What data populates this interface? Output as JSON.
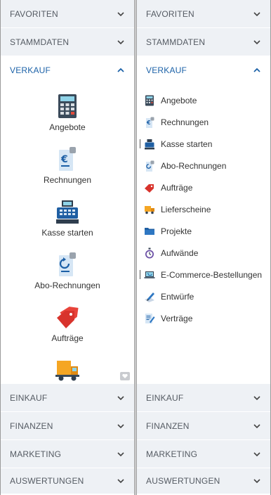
{
  "left_panel": {
    "sections_top": [
      "FAVORITEN",
      "STAMMDATEN"
    ],
    "open_section": "VERKAUF",
    "tiles": [
      {
        "label": "Angebote",
        "icon": "calculator-icon"
      },
      {
        "label": "Rechnungen",
        "icon": "invoice-euro-icon"
      },
      {
        "label": "Kasse starten",
        "icon": "cash-register-icon"
      },
      {
        "label": "Abo-Rechnungen",
        "icon": "recurring-invoice-icon"
      },
      {
        "label": "Aufträge",
        "icon": "tags-icon"
      },
      {
        "label": "",
        "icon": "delivery-truck-icon"
      }
    ],
    "sections_bottom": [
      "EINKAUF",
      "FINANZEN",
      "MARKETING",
      "AUSWERTUNGEN"
    ]
  },
  "right_panel": {
    "sections_top": [
      "FAVORITEN",
      "STAMMDATEN"
    ],
    "open_section": "VERKAUF",
    "items": [
      {
        "label": "Angebote",
        "icon": "calculator-icon"
      },
      {
        "label": "Rechnungen",
        "icon": "invoice-euro-icon"
      },
      {
        "label": "Kasse starten",
        "icon": "cash-register-icon"
      },
      {
        "label": "Abo-Rechnungen",
        "icon": "recurring-invoice-icon"
      },
      {
        "label": "Aufträge",
        "icon": "tags-icon"
      },
      {
        "label": "Lieferscheine",
        "icon": "delivery-truck-icon"
      },
      {
        "label": "Projekte",
        "icon": "folder-icon"
      },
      {
        "label": "Aufwände",
        "icon": "stopwatch-icon"
      },
      {
        "label": "E-Commerce-Bestellungen",
        "icon": "laptop-cart-icon"
      },
      {
        "label": "Entwürfe",
        "icon": "draft-pen-icon"
      },
      {
        "label": "Verträge",
        "icon": "contract-icon"
      }
    ],
    "sections_bottom": [
      "EINKAUF",
      "FINANZEN",
      "MARKETING",
      "AUSWERTUNGEN"
    ]
  },
  "colors": {
    "section_bg": "#eef1f5",
    "section_text": "#555b63",
    "active_text": "#1c62a8",
    "divider": "#c8c8c8"
  }
}
